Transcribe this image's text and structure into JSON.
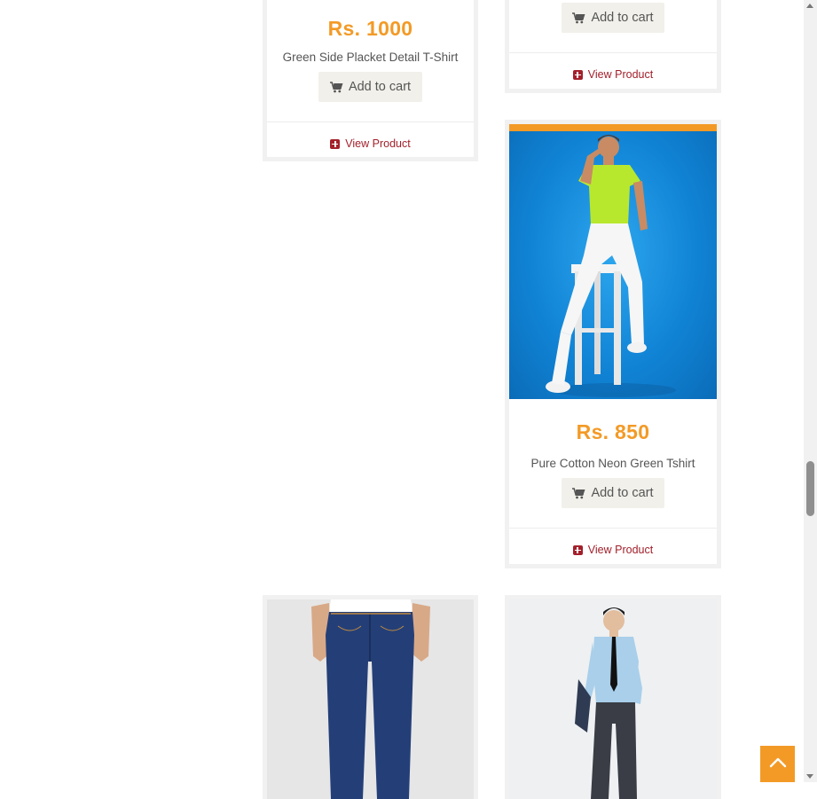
{
  "products": [
    {
      "price": "Rs. 1000",
      "name": "Green Side Placket Detail T-Shirt",
      "add_to_cart": "Add to cart",
      "view_product": "View Product"
    },
    {
      "add_to_cart": "Add to cart",
      "view_product": "View Product"
    },
    {
      "price": "Rs. 850",
      "name": "Pure Cotton Neon Green Tshirt",
      "add_to_cart": "Add to cart",
      "view_product": "View Product"
    }
  ],
  "icons": {
    "cart": "shopping-cart-icon",
    "view": "plus-square-icon",
    "back_to_top": "chevron-up-icon"
  },
  "colors": {
    "price": "#f39a26",
    "accent_bar": "#f39a26",
    "link": "#a3202b",
    "button_bg": "#f1f0ea"
  }
}
